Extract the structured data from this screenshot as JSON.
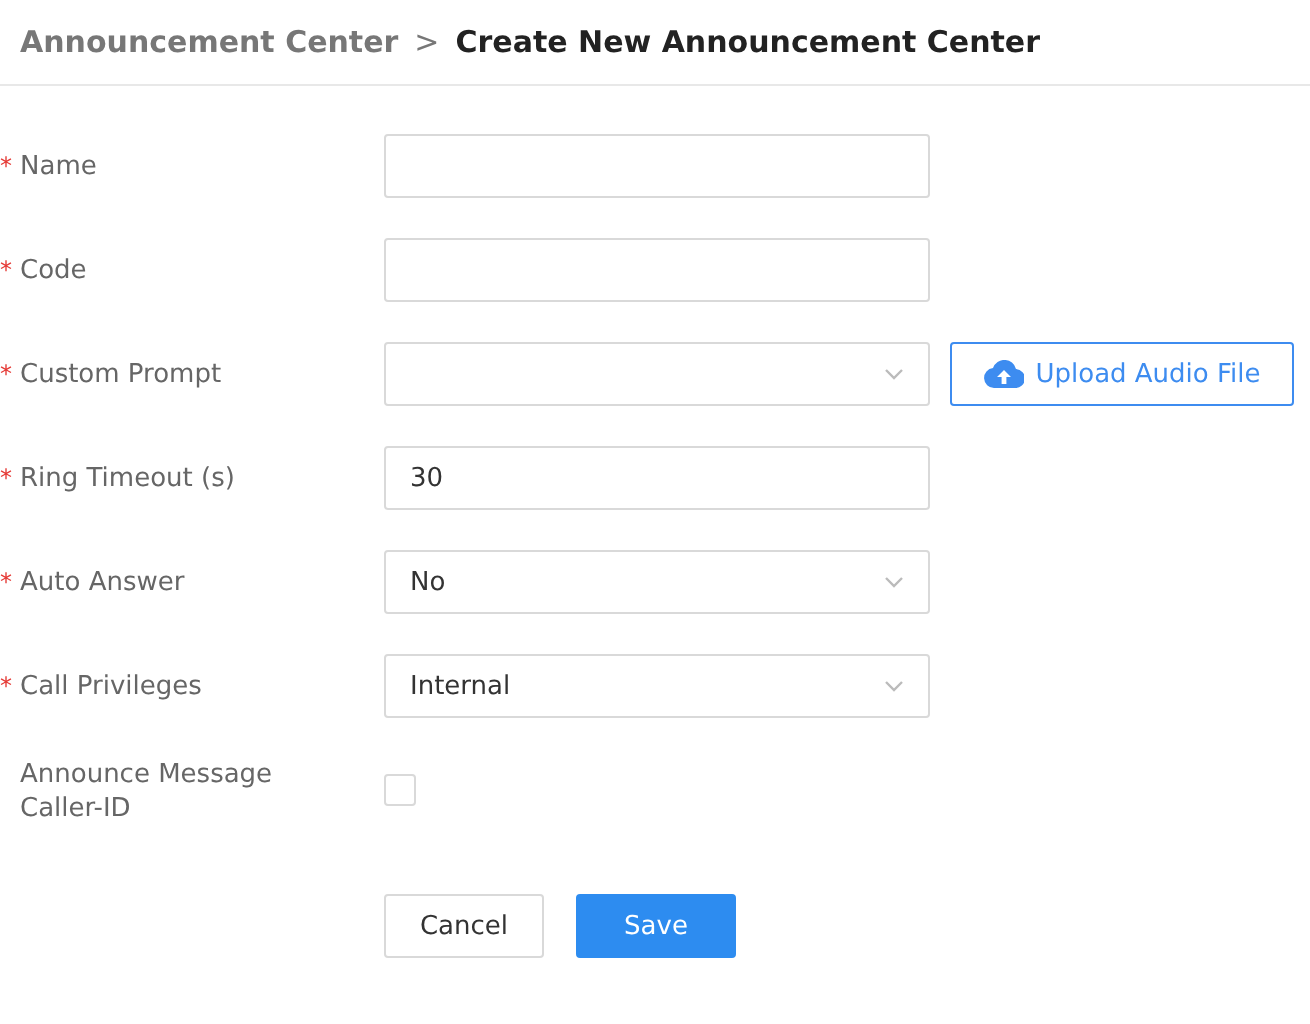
{
  "breadcrumb": {
    "parent": "Announcement Center",
    "separator": ">",
    "current": "Create New Announcement Center"
  },
  "fields": [
    {
      "kind": "text",
      "required_mark": "*",
      "label": "Name"
    },
    {
      "kind": "text",
      "required_mark": "*",
      "label": "Code"
    },
    {
      "kind": "select",
      "required_mark": "*",
      "label": "Custom Prompt",
      "action": "Upload Audio File"
    },
    {
      "kind": "text",
      "required_mark": "*",
      "label": "Ring Timeout (s)",
      "value": "30"
    },
    {
      "kind": "select",
      "required_mark": "*",
      "label": "Auto Answer",
      "value": "No"
    },
    {
      "kind": "select",
      "required_mark": "*",
      "label": "Call Privileges",
      "value": "Internal"
    },
    {
      "kind": "checkbox",
      "label": "Announce Message Caller-ID",
      "checked": false
    }
  ],
  "buttons": [
    {
      "label": "Cancel",
      "kind": "secondary"
    },
    {
      "label": "Save",
      "kind": "primary"
    }
  ]
}
